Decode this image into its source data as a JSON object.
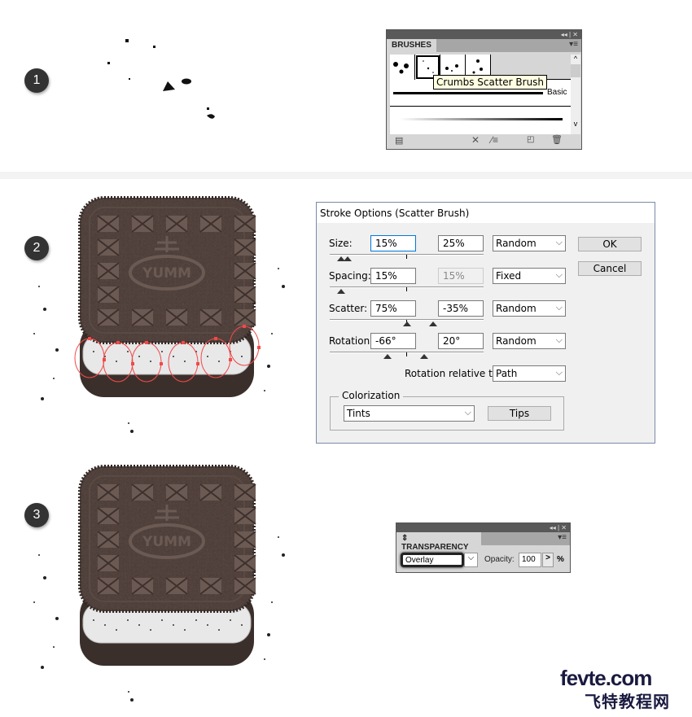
{
  "steps": [
    "1",
    "2",
    "3"
  ],
  "cookie": {
    "logo_text": "YUMM",
    "color": "#4a3b36"
  },
  "brushes_panel": {
    "title": "BRUSHES",
    "tooltip": "Crumbs Scatter Brush",
    "brush_label": "Basic",
    "buttons": [
      "brush-libraries",
      "remove-stroke",
      "options",
      "new-brush",
      "delete-brush"
    ]
  },
  "stroke_dialog": {
    "title": "Stroke Options (Scatter Brush)",
    "rows": [
      {
        "label": "Size:",
        "min": "15%",
        "max": "25%",
        "mode": "Random"
      },
      {
        "label": "Spacing:",
        "min": "15%",
        "max": "15%",
        "mode": "Fixed"
      },
      {
        "label": "Scatter:",
        "min": "75%",
        "max": "-35%",
        "mode": "Random"
      },
      {
        "label": "Rotation:",
        "min": "-66°",
        "max": "20°",
        "mode": "Random"
      }
    ],
    "rotation_relative_label": "Rotation relative to:",
    "rotation_relative_value": "Path",
    "colorization_label": "Colorization",
    "colorization_value": "Tints",
    "tips_label": "Tips",
    "ok_label": "OK",
    "cancel_label": "Cancel"
  },
  "transparency_panel": {
    "title": "TRANSPARENCY",
    "blend_mode": "Overlay",
    "opacity_label": "Opacity:",
    "opacity_value": "100",
    "percent": "%"
  },
  "watermark": {
    "line1": "fevte.com",
    "line2": "飞特教程网"
  }
}
